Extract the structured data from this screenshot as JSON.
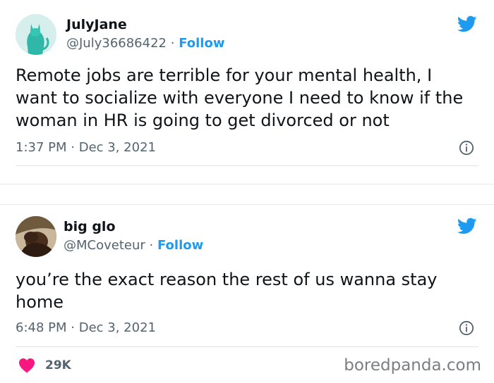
{
  "tweet1": {
    "name": "JulyJane",
    "handle": "@July36686422",
    "separator": "·",
    "follow_label": "Follow",
    "text": "Remote jobs are terrible for your mental health, I want to socialize with everyone I need to know if the woman in HR is going to get divorced or not",
    "time": "1:37 PM",
    "date": "Dec 3, 2021",
    "avatar_icon": "teal-cat-statue-avatar"
  },
  "tweet2": {
    "name": "big glo",
    "handle": "@MCoveteur",
    "separator": "·",
    "follow_label": "Follow",
    "text": "you’re the exact reason the rest of us wanna stay home",
    "time": "6:48 PM",
    "date": "Dec 3, 2021",
    "likes": "29K",
    "avatar_icon": "person-photo-avatar"
  },
  "watermark": "boredpanda.com",
  "colors": {
    "twitter_blue": "#1d9bf0",
    "heart": "#f91880",
    "text": "#0f1419",
    "secondary": "#536471"
  }
}
